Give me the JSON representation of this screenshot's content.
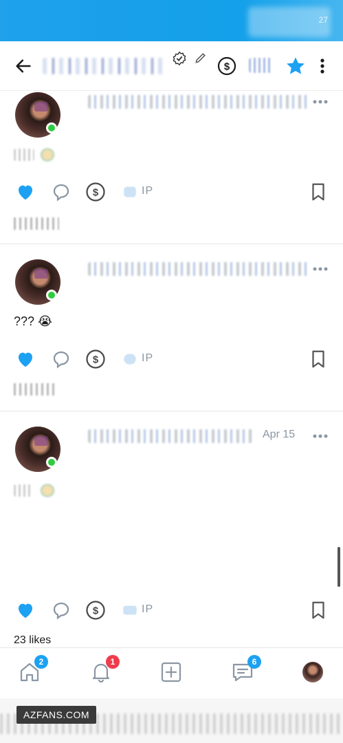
{
  "status_bar": {
    "battery": "27"
  },
  "header": {
    "icons": [
      "back-arrow-icon",
      "verified-icon",
      "edit-icon",
      "dollar-icon",
      "star-icon",
      "more-vertical-icon"
    ],
    "colors": {
      "accent": "#1da1f2",
      "status_bar": "#1fa1ec"
    }
  },
  "posts": [
    {
      "date": "",
      "text": "",
      "tip_label": "IP",
      "likes": ""
    },
    {
      "date": "",
      "text": "??? 😭",
      "tip_label": "IP",
      "likes": ""
    },
    {
      "date": "Apr 15",
      "text": "",
      "tip_label": "IP",
      "likes": "23 likes"
    }
  ],
  "nav": {
    "home_badge": "2",
    "notifications_badge": "1",
    "messages_badge": "6",
    "icons": [
      "home-icon",
      "bell-icon",
      "add-post-icon",
      "messages-icon",
      "profile-avatar"
    ]
  },
  "footer": {
    "watermark": "AZFANS.COM"
  }
}
